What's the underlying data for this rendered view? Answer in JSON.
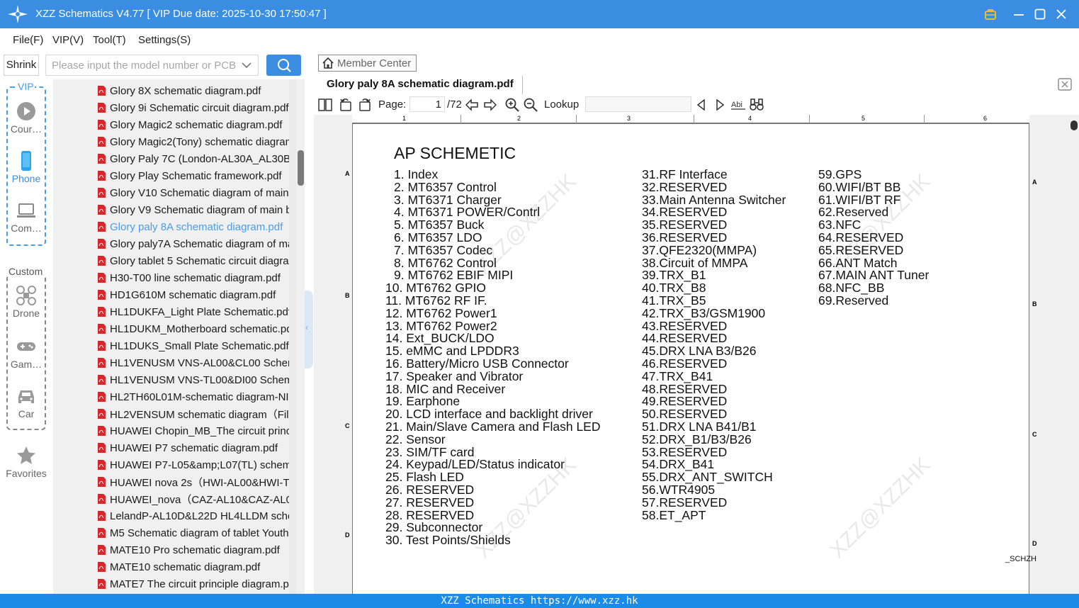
{
  "window": {
    "title": "XZZ Schematics V4.77 [ VIP Due date: 2025-10-30 17:50:47 ]"
  },
  "menu": [
    "File(F)",
    "VIP(V)",
    "Tool(T)",
    "Settings(S)"
  ],
  "search": {
    "shrink_label": "Shrink",
    "placeholder": "Please input the model number or PCB",
    "value": ""
  },
  "categories": {
    "vip_label": "VIP",
    "custom_label": "Custom",
    "items": [
      {
        "label": "Cour…",
        "icon": "play-circle-icon",
        "active": false
      },
      {
        "label": "Phone",
        "icon": "phone-icon",
        "active": true
      },
      {
        "label": "Com…",
        "icon": "laptop-icon",
        "active": false
      },
      {
        "label": "Drone",
        "icon": "drone-icon",
        "active": false
      },
      {
        "label": "Gam…",
        "icon": "gamepad-icon",
        "active": false
      },
      {
        "label": "Car",
        "icon": "car-icon",
        "active": false
      },
      {
        "label": "Favorites",
        "icon": "star-icon",
        "active": false
      }
    ]
  },
  "files": [
    "Glory 8X schematic diagram.pdf",
    "Glory 9i Schematic circuit diagram.pdf",
    "Glory Magic2 schematic diagram.pdf",
    "Glory Magic2(Tony) schematic diagram.pdf",
    "Glory Paly 7C (London-AL30A_AL30B_",
    "Glory Play Schematic framework.pdf",
    "Glory V10 Schematic diagram of main",
    "Glory V9 Schematic diagram of main board",
    "Glory paly 8A schematic diagram.pdf",
    "Glory paly7A Schematic diagram of main",
    "Glory tablet 5 Schematic circuit diagram",
    "H30-T00 line schematic diagram.pdf",
    "HD1G610M schematic diagram.pdf",
    "HL1DUKFA_Light Plate Schematic.pdf",
    "HL1DUKM_Motherboard schematic.pdf",
    "HL1DUKS_Small Plate Schematic.pdf",
    "HL1VENUSM VNS-AL00&CL00 Schematic",
    "HL1VENUSM VNS-TL00&DI00 Schematic",
    "HL2TH60L01M-schematic diagram-NI",
    "HL2VENSUM schematic diagram（File",
    "HUAWEI Chopin_MB_The circuit principle",
    "HUAWEI P7 schematic diagram.pdf",
    "HUAWEI P7-L05&amp;L07(TL) schematic",
    "HUAWEI nova 2s（HWI-AL00&HWI-TL",
    "HUAWEI_nova（CAZ-AL10&CAZ-AL00",
    "LelandP-AL10D&L22D HL4LLDM schematic",
    "M5 Schematic diagram of tablet Youth",
    "MATE10 Pro schematic diagram.pdf",
    "MATE10 schematic diagram.pdf",
    "MATE7 The circuit principle diagram.pdf"
  ],
  "selected_file_index": 8,
  "viewer": {
    "member_center_label": "Member Center",
    "tab_title": "Glory paly 8A schematic diagram.pdf",
    "page_label": "Page:",
    "current_page": "1",
    "total_pages": "/72",
    "lookup_label": "Lookup",
    "lookup_value": ""
  },
  "document": {
    "ruler_numbers": [
      "1",
      "2",
      "3",
      "4",
      "5",
      "6"
    ],
    "row_letters": [
      "A",
      "B",
      "C",
      "D"
    ],
    "title": "AP SCHEMETIC",
    "column1": [
      "1. Index",
      "2. MT6357 Control",
      "3. MT6371 Charger",
      "4. MT6371 POWER/Contrl",
      "5. MT6357 Buck",
      "6. MT6357 LDO",
      "7. MT6357 Codec",
      "8. MT6762 Control",
      "9. MT6762 EBIF MIPI",
      "10. MT6762 GPIO",
      "11. MT6762 RF IF.",
      "12. MT6762 Power1",
      "13. MT6762 Power2",
      "14. Ext_BUCK/LDO",
      "15. eMMC and LPDDR3",
      "16. Battery/Micro USB Connector",
      "17. Speaker and Vibrator",
      "18. MIC and Receiver",
      "19. Earphone",
      "20. LCD interface and backlight driver",
      "21. Main/Slave Camera and Flash LED",
      "22. Sensor",
      "23. SIM/TF card",
      "24. Keypad/LED/Status indicator",
      "25. Flash LED",
      "26. RESERVED",
      "27. RESERVED",
      "28. RESERVED",
      "29. Subconnector",
      "30. Test Points/Shields"
    ],
    "column2": [
      "31.RF Interface",
      "32.RESERVED",
      "33.Main Antenna Switcher",
      "34.RESERVED",
      "35.RESERVED",
      "36.RESERVED",
      "37.QFE2320(MMPA)",
      "38.Circuit of MMPA",
      "39.TRX_B1",
      "40.TRX_B8",
      "41.TRX_B5",
      "42.TRX_B3/GSM1900",
      "43.RESERVED",
      "44.RESERVED",
      "45.DRX LNA B3/B26",
      "46.RESERVED",
      "47.TRX_B41",
      "48.RESERVED",
      "49.RESERVED",
      "50.RESERVED",
      "51.DRX LNA B41/B1",
      "52.DRX_B1/B3/B26",
      "53.RESERVED",
      "54.DRX_B41",
      "55.DRX_ANT_SWITCH",
      "56.WTR4905",
      "57.RESERVED",
      "58.ET_APT"
    ],
    "column3": [
      "59.GPS",
      "60.WIFI/BT BB",
      "61.WIFI/BT RF",
      "62.Reserved",
      "63.NFC",
      "64.RESERVED",
      "65.RESERVED",
      "66.ANT Match",
      "67.MAIN ANT Tuner",
      "68.NFC_BB",
      "69.Reserved"
    ],
    "watermark": "XZZ@XZZHK",
    "suffix_note": "_SCHZH"
  },
  "status_bar": "XZZ Schematics https://www.xzz.hk"
}
